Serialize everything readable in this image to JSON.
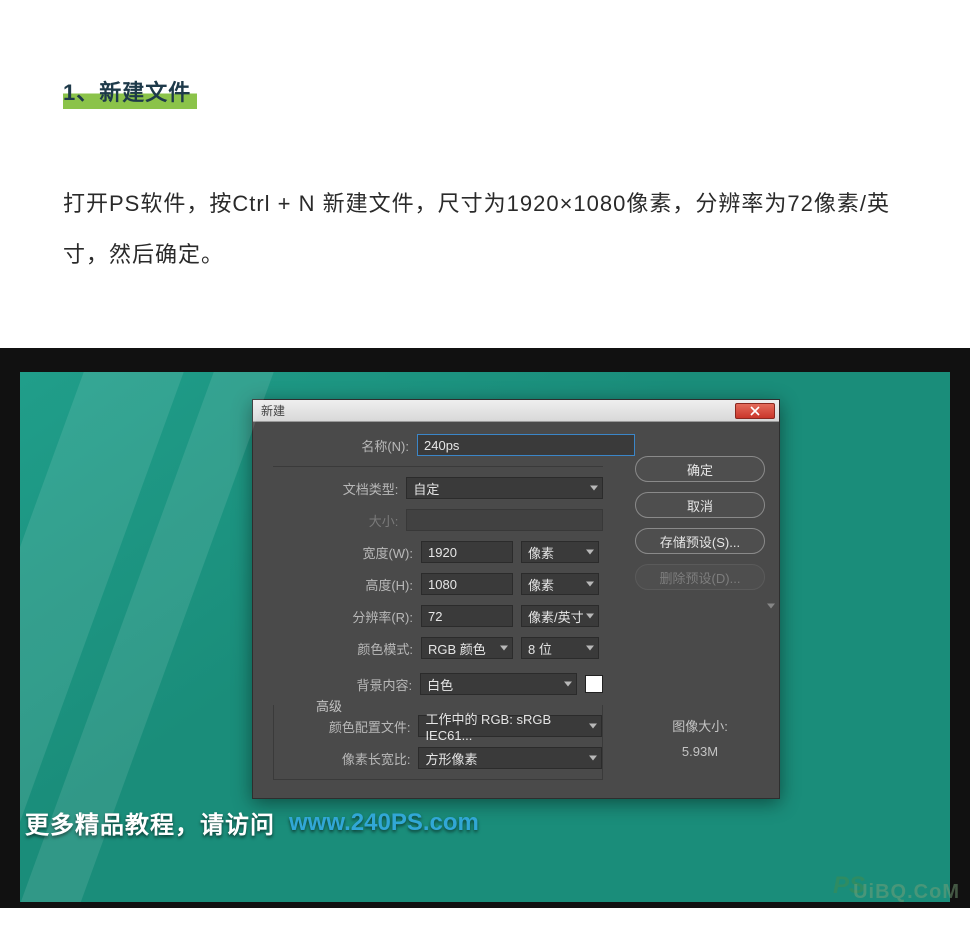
{
  "article": {
    "heading": "1、新建文件",
    "instruction": "打开PS软件，按Ctrl + N 新建文件，尺寸为1920×1080像素，分辨率为72像素/英寸，然后确定。"
  },
  "dialog": {
    "title": "新建",
    "labels": {
      "name": "名称(N):",
      "doc_type": "文档类型:",
      "size": "大小:",
      "width": "宽度(W):",
      "height": "高度(H):",
      "resolution": "分辨率(R):",
      "color_mode": "颜色模式:",
      "background": "背景内容:",
      "advanced": "高级",
      "color_profile": "颜色配置文件:",
      "pixel_aspect": "像素长宽比:"
    },
    "values": {
      "name": "240ps",
      "doc_type": "自定",
      "size": "",
      "width": "1920",
      "width_unit": "像素",
      "height": "1080",
      "height_unit": "像素",
      "resolution": "72",
      "resolution_unit": "像素/英寸",
      "color_mode": "RGB 颜色",
      "bit_depth": "8 位",
      "background": "白色",
      "color_profile": "工作中的 RGB: sRGB IEC61...",
      "pixel_aspect": "方形像素"
    },
    "buttons": {
      "ok": "确定",
      "cancel": "取消",
      "save_preset": "存储预设(S)...",
      "delete_preset": "删除预设(D)..."
    },
    "info": {
      "label": "图像大小:",
      "value": "5.93M"
    }
  },
  "watermark": {
    "text": "更多精品教程，请访问",
    "url": "www.240PS.com",
    "corner": "UiBQ.CoM",
    "ps": "PS"
  }
}
